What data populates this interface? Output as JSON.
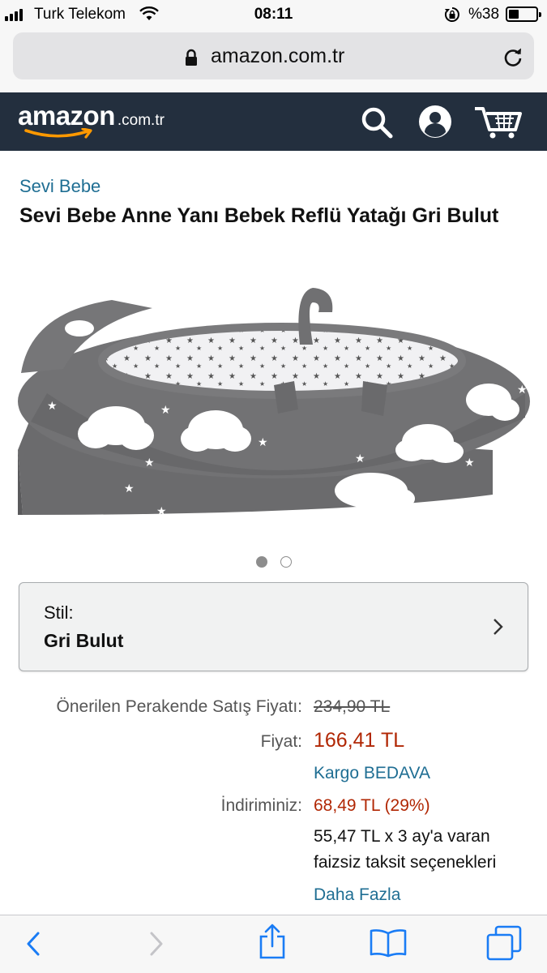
{
  "status_bar": {
    "carrier": "Turk Telekom",
    "time": "08:11",
    "battery_percent": "%38",
    "battery_level": 0.38
  },
  "browser": {
    "url": "amazon.com.tr"
  },
  "header": {
    "logo_word": "amazon",
    "logo_tld": ".com.tr",
    "icons": [
      "search-icon",
      "account-icon",
      "cart-icon"
    ]
  },
  "product": {
    "brand": "Sevi Bebe",
    "title": "Sevi Bebe Anne Yanı Bebek Reflü Yatağı Gri Bulut",
    "image_count": 2,
    "image_index": 1
  },
  "style": {
    "label": "Stil:",
    "value": "Gri Bulut"
  },
  "pricing": {
    "list_price_label": "Önerilen Perakende Satış Fiyatı:",
    "list_price": "234,90 TL",
    "price_label": "Fiyat:",
    "price": "166,41 TL",
    "shipping": "Kargo BEDAVA",
    "savings_label": "İndiriminiz:",
    "savings": "68,49 TL (29%)",
    "installment": "55,47 TL x 3 ay'a varan faizsiz taksit seçenekleri",
    "more_link": "Daha Fazla"
  },
  "colors": {
    "amazon_header": "#232f3e",
    "link": "#1f6e93",
    "price_red": "#b12704",
    "ios_blue": "#1a7cf5"
  },
  "toolbar": {
    "icons": [
      "back-icon",
      "forward-icon",
      "share-icon",
      "bookmarks-icon",
      "tabs-icon"
    ]
  }
}
